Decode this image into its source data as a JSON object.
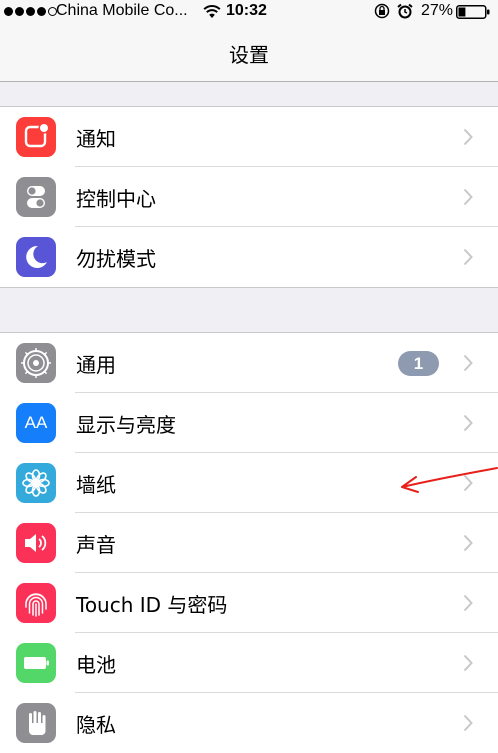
{
  "status_bar": {
    "signal_bars_full": 4,
    "signal_bars_total": 5,
    "carrier": "China Mobile Co...",
    "time": "10:32",
    "battery_percent": "27%",
    "battery_level": 0.27
  },
  "nav": {
    "title": "设置"
  },
  "groups": [
    {
      "items": [
        {
          "label": "通知",
          "icon": "notifications-icon",
          "color": "#fc3d39"
        },
        {
          "label": "控制中心",
          "icon": "control-center-icon",
          "color": "#8e8e93"
        },
        {
          "label": "勿扰模式",
          "icon": "moon-icon",
          "color": "#5856d6"
        }
      ]
    },
    {
      "items": [
        {
          "label": "通用",
          "icon": "gear-icon",
          "color": "#8e8e93",
          "badge": "1"
        },
        {
          "label": "显示与亮度",
          "icon": "display-brightness-icon",
          "color": "#147efb",
          "glyph": "AA"
        },
        {
          "label": "墙纸",
          "icon": "wallpaper-flower-icon",
          "color": "#34aadc"
        },
        {
          "label": "声音",
          "icon": "speaker-icon",
          "color": "#fc3158"
        },
        {
          "label": "Touch ID 与密码",
          "icon": "fingerprint-icon",
          "color": "#fc3158"
        },
        {
          "label": "电池",
          "icon": "battery-icon",
          "color": "#53d769"
        },
        {
          "label": "隐私",
          "icon": "hand-icon",
          "color": "#8e8e93"
        }
      ]
    }
  ],
  "annotation": {
    "color": "#e8201b",
    "meaning": "red hand-drawn arrow pointing at 墙纸 row"
  }
}
